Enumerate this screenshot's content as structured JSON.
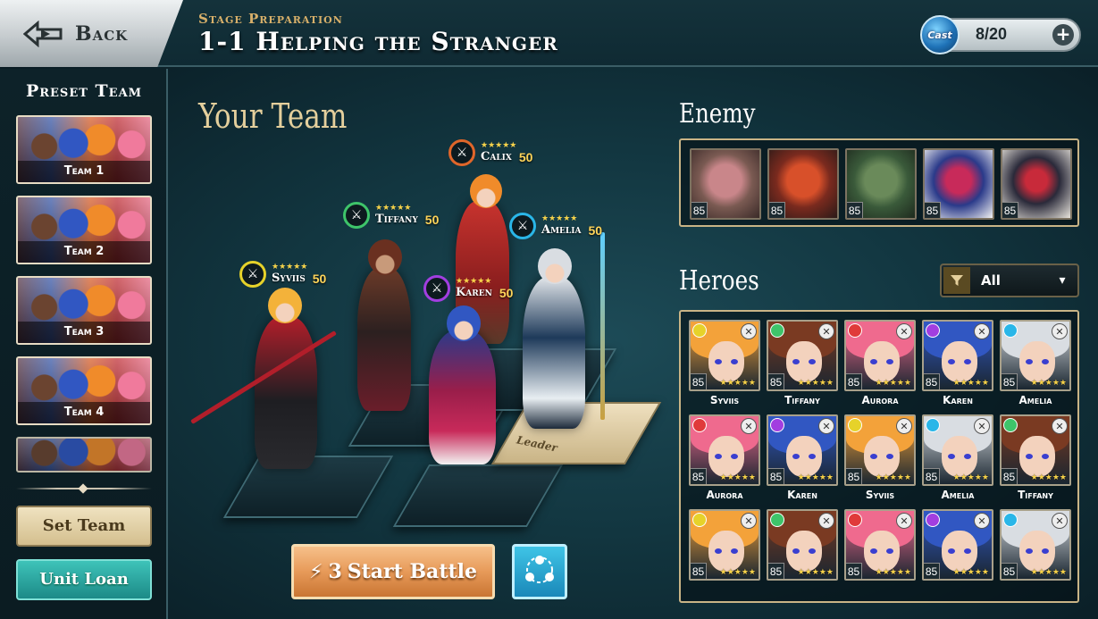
{
  "header": {
    "back_label": "Back",
    "stage_label": "Stage Preparation",
    "stage_title": "1-1 Helping the Stranger",
    "cast": {
      "icon": "Cast",
      "value": "8/20",
      "plus": "+"
    }
  },
  "preset": {
    "title": "Preset Team",
    "teams": [
      "Team 1",
      "Team 2",
      "Team 3",
      "Team 4"
    ],
    "set_team_label": "Set Team",
    "unit_loan_label": "Unit Loan"
  },
  "your_team": {
    "title": "Your Team",
    "leader_label": "Leader",
    "members": [
      {
        "name": "Calix",
        "level": "50",
        "stars": "★★★★★",
        "element_color": "#e0662a"
      },
      {
        "name": "Tiffany",
        "level": "50",
        "stars": "★★★★★",
        "element_color": "#3ec46a"
      },
      {
        "name": "Amelia",
        "level": "50",
        "stars": "★★★★★",
        "element_color": "#2ab6e8"
      },
      {
        "name": "Syviis",
        "level": "50",
        "stars": "★★★★★",
        "element_color": "#e6d22a"
      },
      {
        "name": "Karen",
        "level": "50",
        "stars": "★★★★★",
        "element_color": "#a23ee0"
      }
    ]
  },
  "actions": {
    "start_battle_cost": "3",
    "start_battle_label": "Start Battle",
    "formation_icon": "formation-icon"
  },
  "enemy": {
    "title": "Enemy",
    "levels": [
      "85",
      "85",
      "85",
      "85",
      "85"
    ]
  },
  "heroes": {
    "title": "Heroes",
    "filter_label": "All",
    "list": [
      {
        "name": "Syviis",
        "level": "85",
        "stars": "★★★★★",
        "element": "#e6d22a",
        "hair": "#f3a23a"
      },
      {
        "name": "Tiffany",
        "level": "85",
        "stars": "★★★★★",
        "element": "#3ec46a",
        "hair": "#7a3a22"
      },
      {
        "name": "Aurora",
        "level": "85",
        "stars": "★★★★★",
        "element": "#e03a3a",
        "hair": "#ef6a8e"
      },
      {
        "name": "Karen",
        "level": "85",
        "stars": "★★★★★",
        "element": "#a23ee0",
        "hair": "#3157c2"
      },
      {
        "name": "Amelia",
        "level": "85",
        "stars": "★★★★★",
        "element": "#2ab6e8",
        "hair": "#d9dde2"
      },
      {
        "name": "Aurora",
        "level": "85",
        "stars": "★★★★★",
        "element": "#e03a3a",
        "hair": "#ef6a8e"
      },
      {
        "name": "Karen",
        "level": "85",
        "stars": "★★★★★",
        "element": "#a23ee0",
        "hair": "#3157c2"
      },
      {
        "name": "Syviis",
        "level": "85",
        "stars": "★★★★★",
        "element": "#e6d22a",
        "hair": "#f3a23a"
      },
      {
        "name": "Amelia",
        "level": "85",
        "stars": "★★★★★",
        "element": "#2ab6e8",
        "hair": "#d9dde2"
      },
      {
        "name": "Tiffany",
        "level": "85",
        "stars": "★★★★★",
        "element": "#3ec46a",
        "hair": "#7a3a22"
      },
      {
        "name": "",
        "level": "85",
        "stars": "★★★★★",
        "element": "#e6d22a",
        "hair": "#f3a23a"
      },
      {
        "name": "",
        "level": "85",
        "stars": "★★★★★",
        "element": "#3ec46a",
        "hair": "#7a3a22"
      },
      {
        "name": "",
        "level": "85",
        "stars": "★★★★★",
        "element": "#e03a3a",
        "hair": "#ef6a8e"
      },
      {
        "name": "",
        "level": "85",
        "stars": "★★★★★",
        "element": "#a23ee0",
        "hair": "#3157c2"
      },
      {
        "name": "",
        "level": "85",
        "stars": "★★★★★",
        "element": "#2ab6e8",
        "hair": "#d9dde2"
      }
    ]
  }
}
